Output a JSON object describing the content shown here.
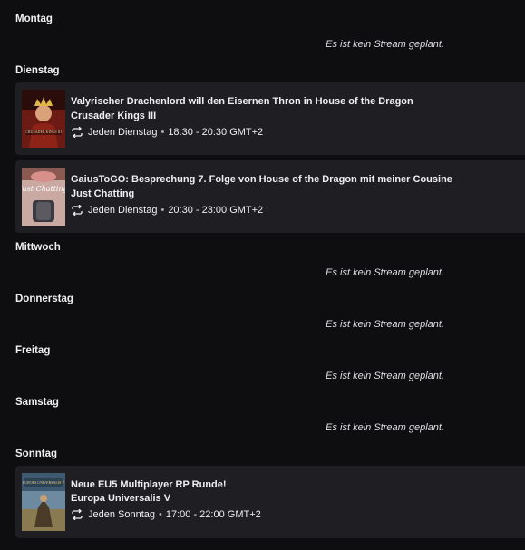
{
  "no_stream_text": "Es ist kein Stream geplant.",
  "days": {
    "montag": {
      "label": "Montag"
    },
    "dienstag": {
      "label": "Dienstag",
      "streams": [
        {
          "title": "Valyrischer Drachenlord will den Eisernen Thron in House of the Dragon",
          "category": "Crusader Kings III",
          "recurrence": "Jeden Dienstag",
          "time": "18:30 - 20:30 GMT+2",
          "thumb_text": "CRUSADER KINGS III"
        },
        {
          "title": "GaiusToGO: Besprechung 7. Folge von House of the Dragon mit meiner Cousine",
          "category": "Just Chatting",
          "recurrence": "Jeden Dienstag",
          "time": "20:30 - 23:00 GMT+2",
          "thumb_text": "Just Chatting"
        }
      ]
    },
    "mittwoch": {
      "label": "Mittwoch"
    },
    "donnerstag": {
      "label": "Donnerstag"
    },
    "freitag": {
      "label": "Freitag"
    },
    "samstag": {
      "label": "Samstag"
    },
    "sonntag": {
      "label": "Sonntag",
      "streams": [
        {
          "title": "Neue EU5 Multiplayer RP Runde!",
          "category": "Europa Universalis V",
          "recurrence": "Jeden Sonntag",
          "time": "17:00 - 22:00 GMT+2",
          "thumb_text": "EUROPA UNIVERSALIS V"
        }
      ]
    }
  },
  "colors": {
    "background": "#0e0e10",
    "card": "#1f1f23",
    "text": "#efeff1"
  },
  "icons": {
    "recurrence": "repeat-icon"
  }
}
